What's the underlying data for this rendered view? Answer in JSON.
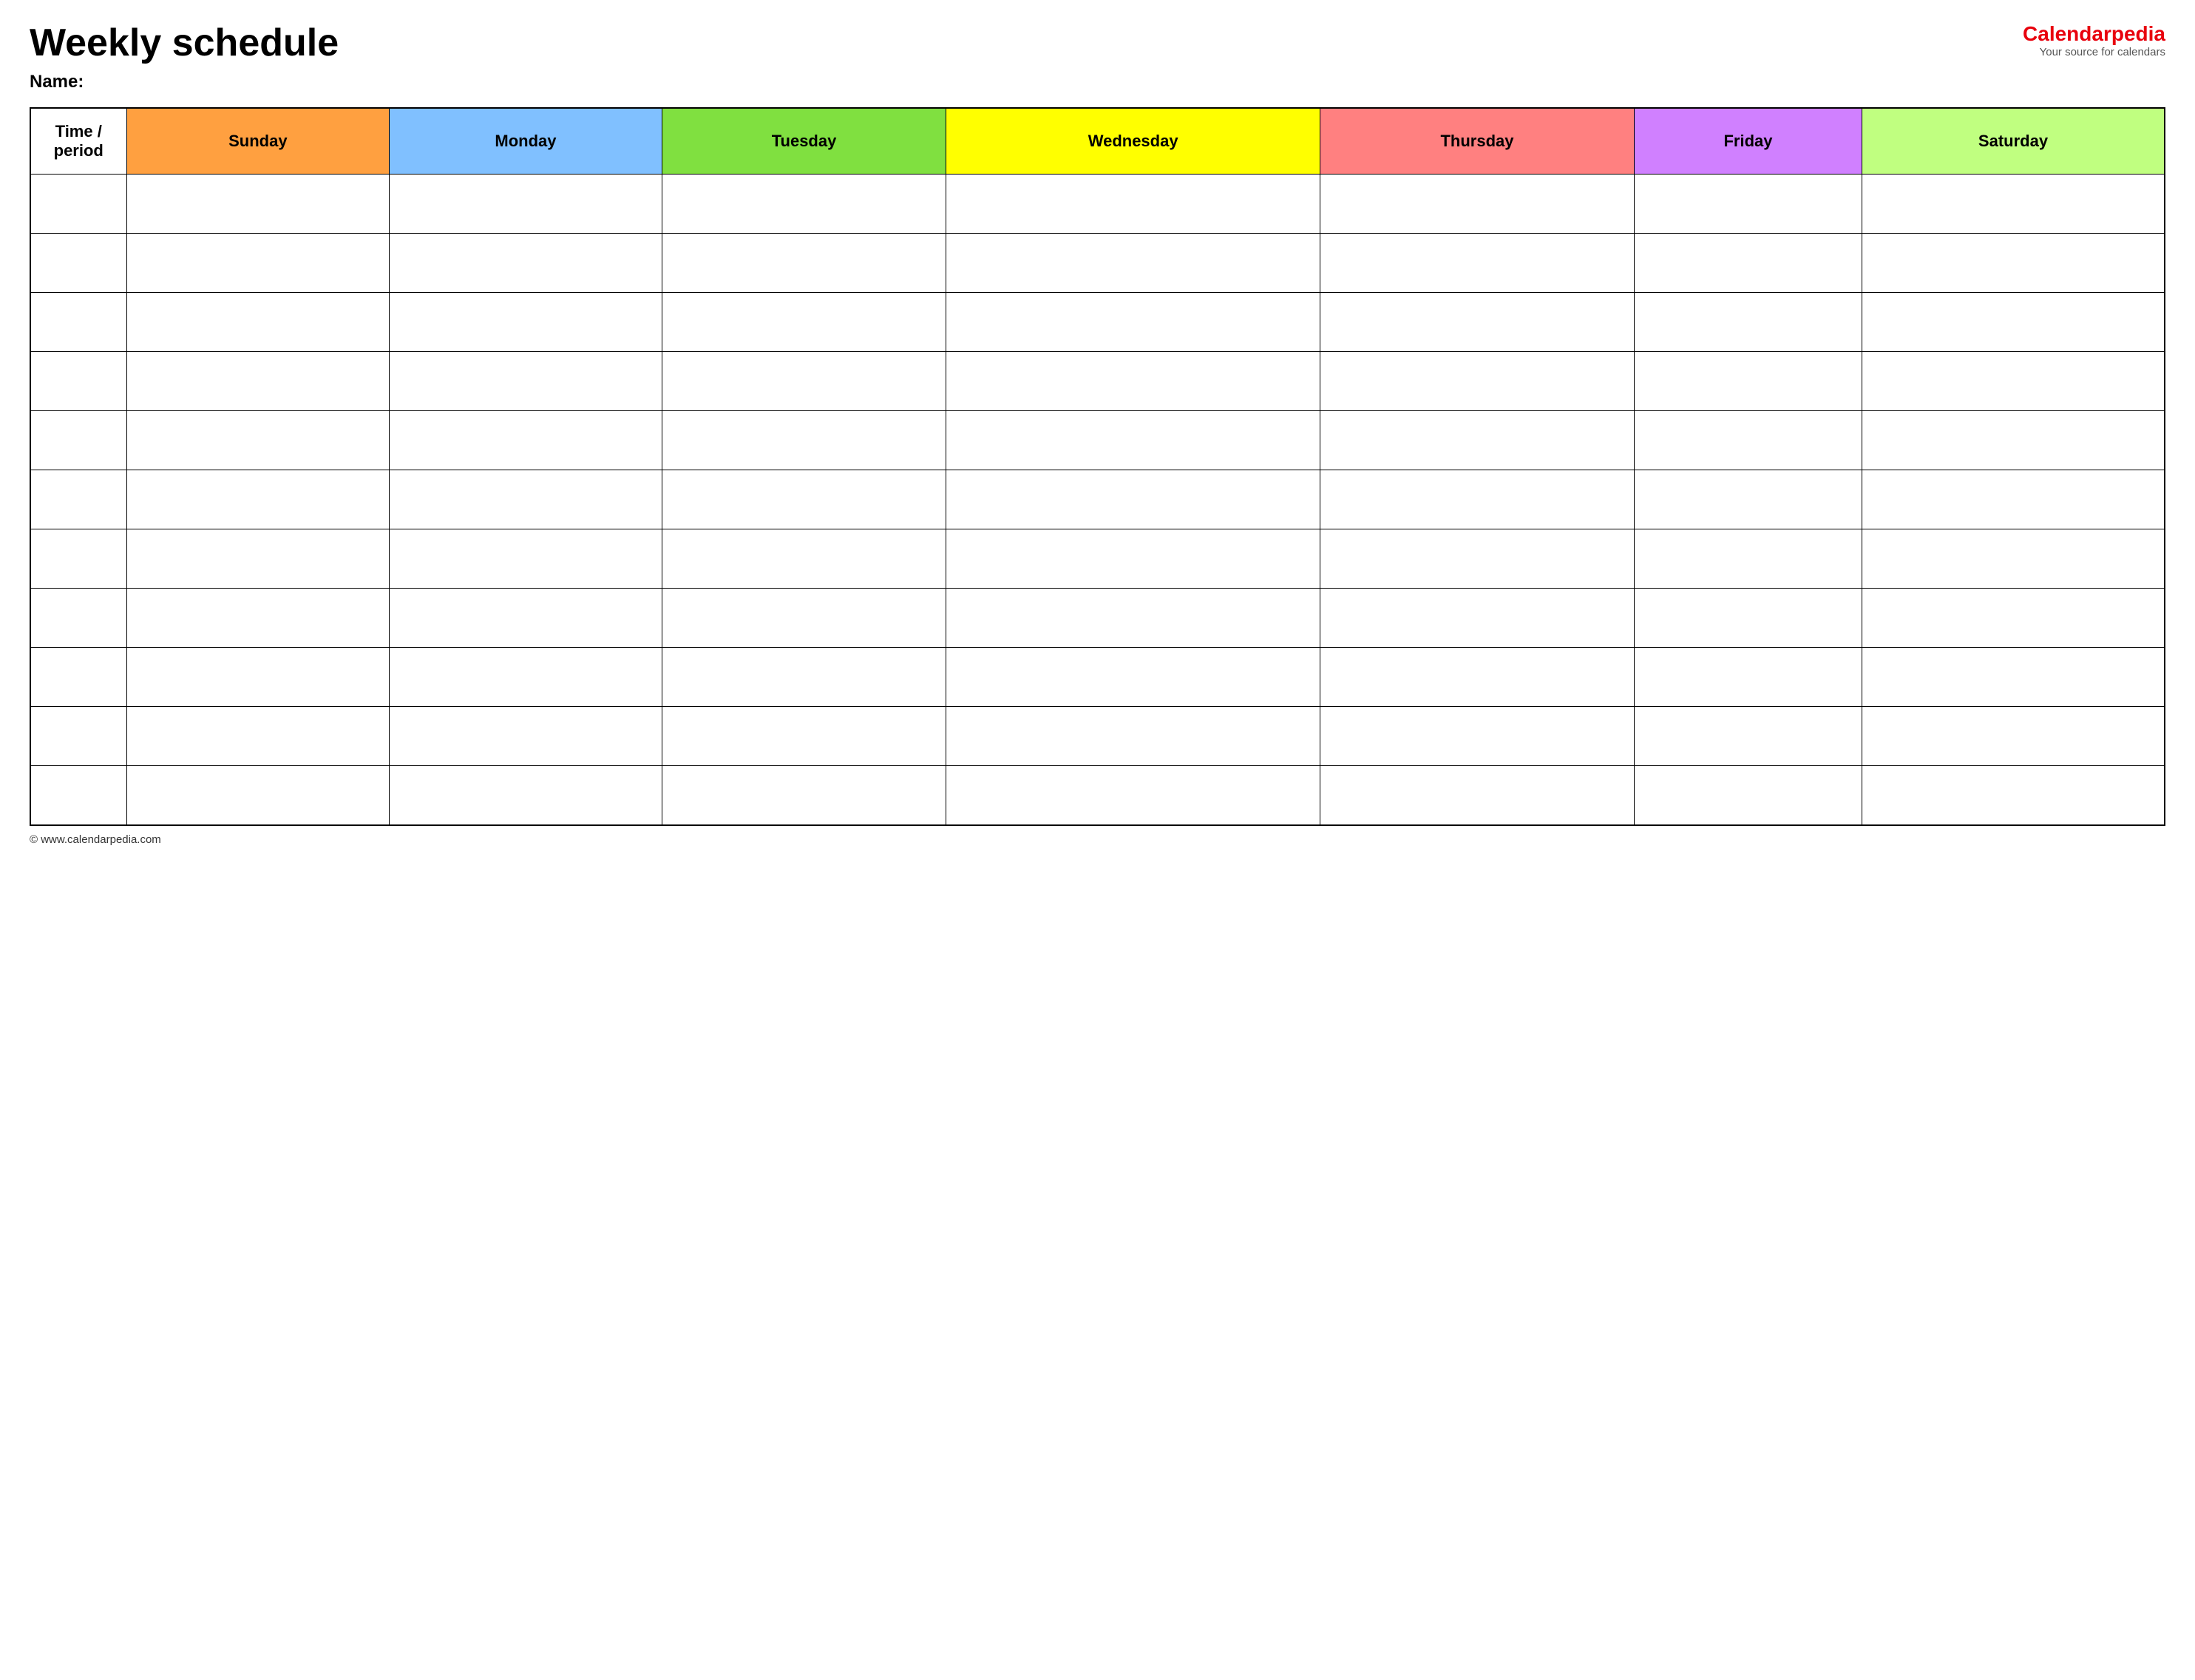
{
  "header": {
    "title": "Weekly schedule",
    "logo_brand": "Calendar",
    "logo_brand_red": "pedia",
    "logo_subtitle": "Your source for calendars"
  },
  "name_label": "Name:",
  "columns": [
    {
      "id": "time",
      "label": "Time / period",
      "class": "col-time"
    },
    {
      "id": "sunday",
      "label": "Sunday",
      "class": "col-sunday"
    },
    {
      "id": "monday",
      "label": "Monday",
      "class": "col-monday"
    },
    {
      "id": "tuesday",
      "label": "Tuesday",
      "class": "col-tuesday"
    },
    {
      "id": "wednesday",
      "label": "Wednesday",
      "class": "col-wednesday"
    },
    {
      "id": "thursday",
      "label": "Thursday",
      "class": "col-thursday"
    },
    {
      "id": "friday",
      "label": "Friday",
      "class": "col-friday"
    },
    {
      "id": "saturday",
      "label": "Saturday",
      "class": "col-saturday"
    }
  ],
  "row_count": 11,
  "footer": {
    "url": "© www.calendarpedia.com"
  }
}
